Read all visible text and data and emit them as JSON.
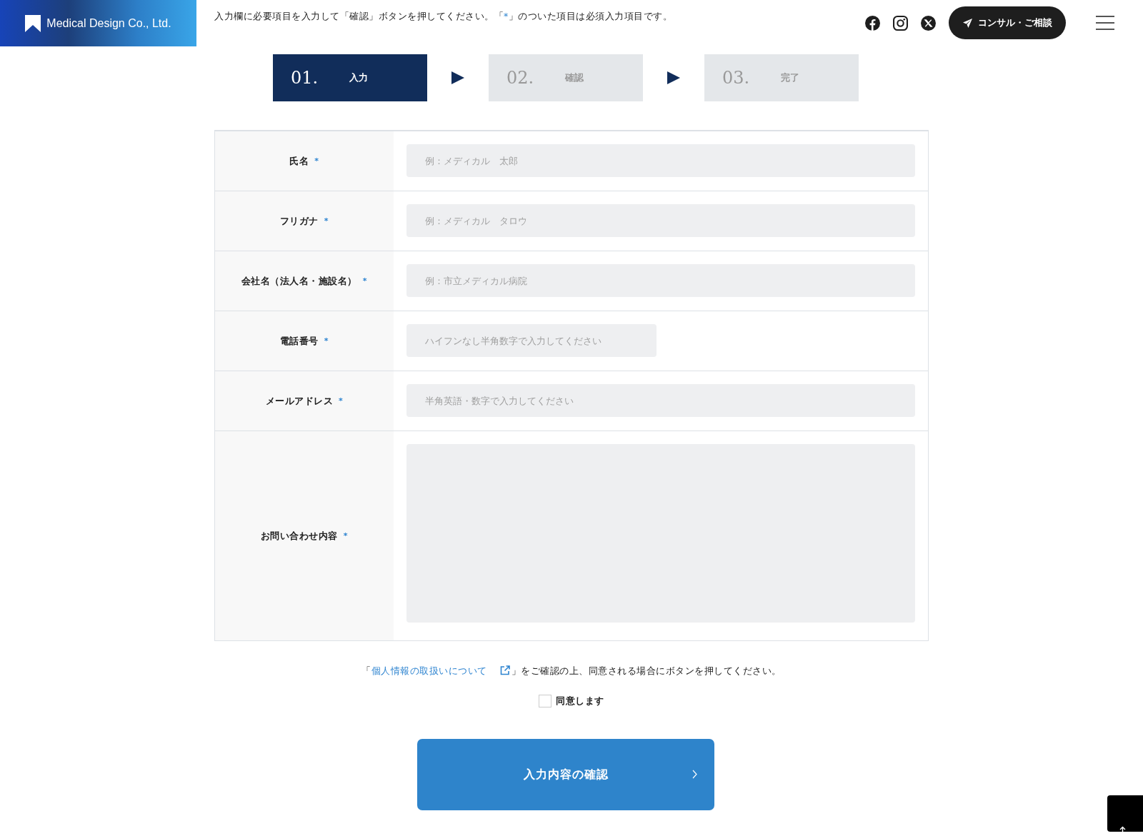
{
  "header": {
    "logo": "Medical Design Co., Ltd.",
    "notice": {
      "before": "入力欄に必要項目を入力して「確認」ボタンを押してください。「",
      "mark": "*",
      "after": "」のついた項目は必須入力項目です。"
    },
    "consult_button": "コンサル・ご相談"
  },
  "steps": [
    {
      "number": "01.",
      "label": "入力",
      "selected": true
    },
    {
      "number": "02.",
      "label": "確認",
      "selected": false
    },
    {
      "number": "03.",
      "label": "完了",
      "selected": false
    }
  ],
  "fields": [
    {
      "kind": "text",
      "label": "氏名",
      "required_mark": "*",
      "placeholder": "例：メディカル　太郎"
    },
    {
      "kind": "text",
      "label": "フリガナ",
      "required_mark": "*",
      "placeholder": "例：メディカル　タロウ"
    },
    {
      "kind": "text",
      "label": "会社名（法人名・施設名）",
      "required_mark": "*",
      "placeholder": "例：市立メディカル病院"
    },
    {
      "kind": "short",
      "label": "電話番号",
      "required_mark": "*",
      "placeholder": "ハイフンなし半角数字で入力してください"
    },
    {
      "kind": "text",
      "label": "メールアドレス",
      "required_mark": "*",
      "placeholder": "半角英語・数字で入力してください"
    },
    {
      "kind": "textarea",
      "label": "お問い合わせ内容",
      "required_mark": "*"
    }
  ],
  "privacy": {
    "open": "「",
    "link": "個人情報の取扱いについて",
    "after": "」をご確認の上、同意される場合にボタンを押してください。"
  },
  "agree": {
    "label": "同意します",
    "checked": false
  },
  "submit_button": "入力内容の確認"
}
